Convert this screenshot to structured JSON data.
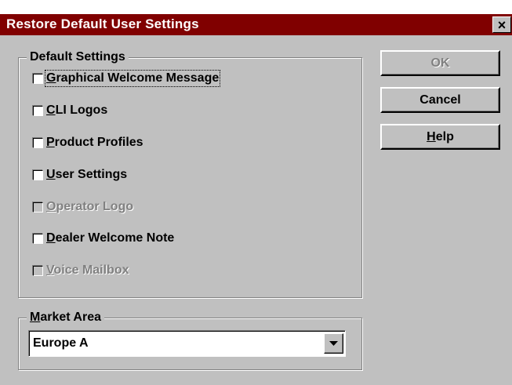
{
  "window": {
    "title": "Restore Default User Settings",
    "close_label": "×"
  },
  "default_settings": {
    "legend": "Default Settings",
    "items": [
      {
        "mnemonic": "G",
        "rest": "raphical Welcome Message",
        "checked": false,
        "enabled": true,
        "focused": true
      },
      {
        "mnemonic": "C",
        "rest": "LI Logos",
        "checked": false,
        "enabled": true,
        "focused": false
      },
      {
        "mnemonic": "P",
        "rest": "roduct Profiles",
        "checked": false,
        "enabled": true,
        "focused": false
      },
      {
        "mnemonic": "U",
        "rest": "ser Settings",
        "checked": false,
        "enabled": true,
        "focused": false
      },
      {
        "mnemonic": "O",
        "rest": "perator Logo",
        "checked": false,
        "enabled": false,
        "focused": false
      },
      {
        "mnemonic": "D",
        "rest": "ealer Welcome Note",
        "checked": false,
        "enabled": true,
        "focused": false
      },
      {
        "mnemonic": "V",
        "rest": "oice Mailbox",
        "checked": false,
        "enabled": false,
        "focused": false
      }
    ]
  },
  "market_area": {
    "legend_mnemonic": "M",
    "legend_rest": "arket Area",
    "selected": "Europe A"
  },
  "buttons": {
    "ok": "OK",
    "cancel": "Cancel",
    "help_mnemonic": "H",
    "help_rest": "elp"
  },
  "colors": {
    "titlebar": "#800000",
    "face": "#c0c0c0",
    "disabled_text": "#808080"
  }
}
